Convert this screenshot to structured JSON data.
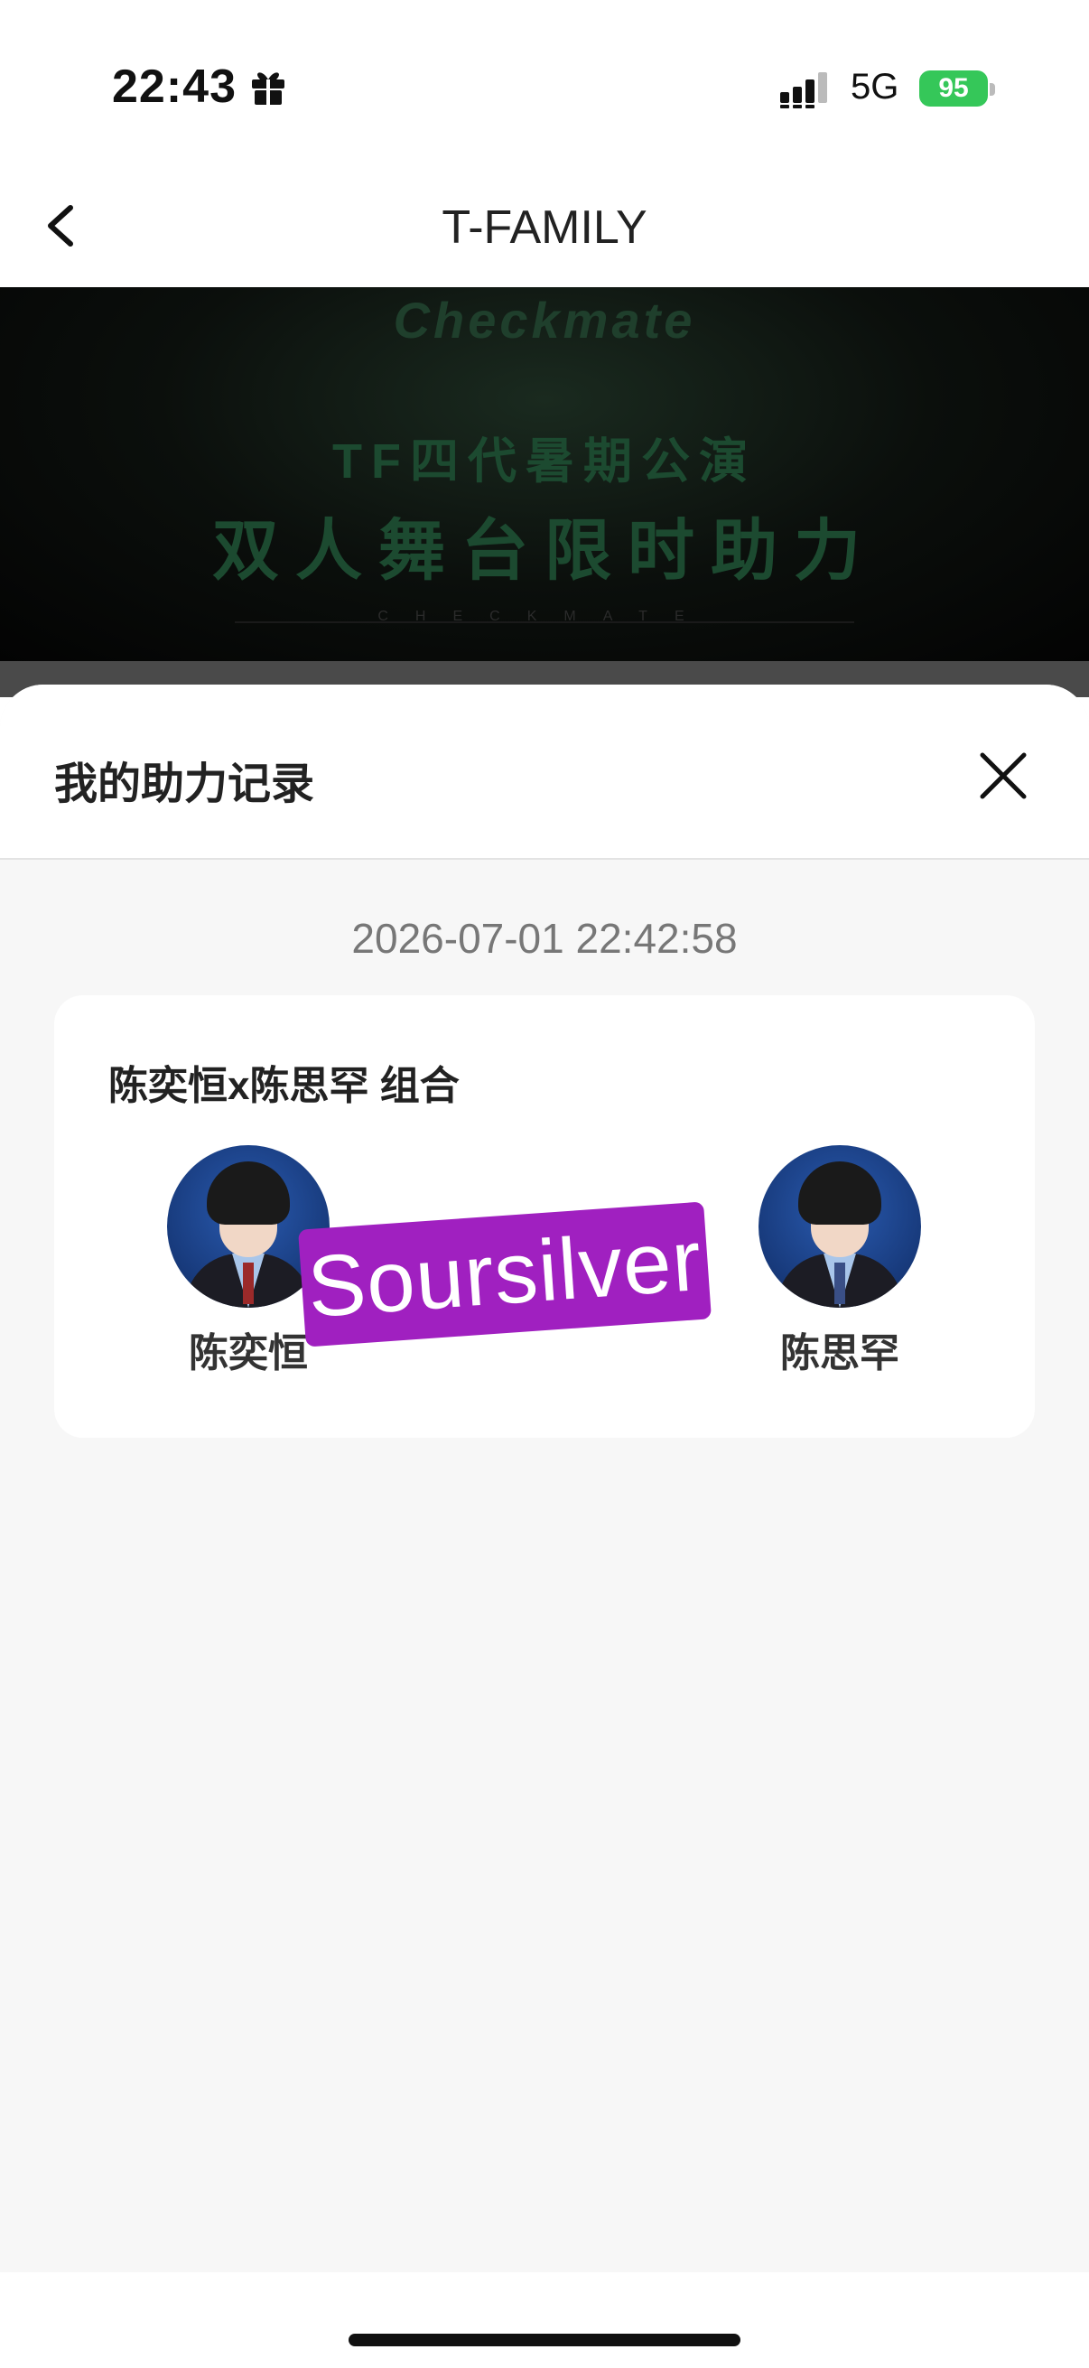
{
  "status_bar": {
    "time": "22:43",
    "network": "5G",
    "battery": "95"
  },
  "nav": {
    "title": "T-FAMILY"
  },
  "banner": {
    "logo": "Checkmate",
    "subtitle": "TF四代暑期公演",
    "headline": "双人舞台限时助力",
    "tagline": "CHECKMATE"
  },
  "sheet": {
    "title": "我的助力记录",
    "record": {
      "timestamp": "2026-07-01 22:42:58",
      "group_title": "陈奕恒x陈思罕 组合",
      "members": [
        {
          "name": "陈奕恒"
        },
        {
          "name": "陈思罕"
        }
      ]
    }
  },
  "watermark": {
    "text": "Soursilver"
  },
  "colors": {
    "battery": "#35c759",
    "watermark": "#a020c0",
    "banner_text": "#1c4a30"
  },
  "icons": [
    "gift-icon",
    "signal-icon",
    "back-arrow-icon",
    "close-icon"
  ]
}
